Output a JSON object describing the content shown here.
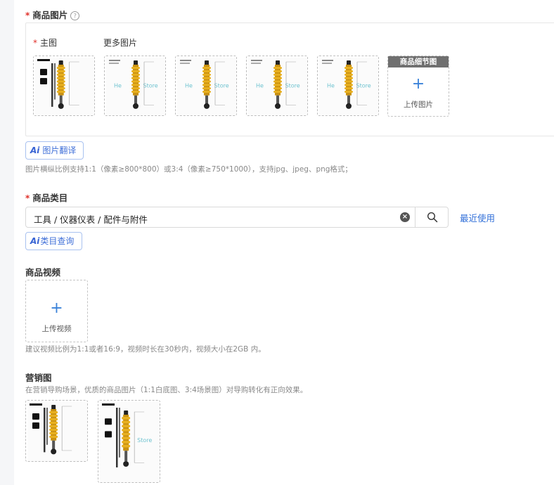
{
  "images_section": {
    "title": "商品图片",
    "main_image_label": "主图",
    "more_images_label": "更多图片",
    "thumbnails": [
      {
        "variant": "main-text"
      },
      {
        "variant": "watermark",
        "watermark_text": "He    Store"
      },
      {
        "variant": "watermark",
        "watermark_text": "He    Store"
      },
      {
        "variant": "watermark",
        "watermark_text": "He    Store"
      },
      {
        "variant": "watermark",
        "watermark_text": "He    Store"
      }
    ],
    "detail_slot": {
      "header": "商品细节图",
      "icon": "plus-icon",
      "label": "上传图片"
    },
    "ai_translate_button": {
      "badge": "Ai",
      "label": "图片翻译"
    },
    "hint": "图片横纵比例支持1:1（像素≥800*800）或3:4（像素≥750*1000），支持jpg、jpeg、png格式；"
  },
  "category_section": {
    "title": "商品类目",
    "value": "工具 / 仪器仪表 / 配件与附件",
    "recent_link": "最近使用",
    "ai_query_button": {
      "badge": "Ai",
      "label": "类目查询"
    }
  },
  "video_section": {
    "title": "商品视频",
    "upload_label": "上传视频",
    "hint": "建议视频比例为1:1或者16:9，视频时长在30秒内，视频大小在2GB 内。"
  },
  "marketing_section": {
    "title": "营销图",
    "hint": "在营销导购场景，优质的商品图片（1:1白底图、3:4场景图）对导购转化有正向效果。"
  },
  "colors": {
    "required_mark": "#e0302a",
    "link": "#2f6ed8",
    "shock_spring": "#e8b020",
    "detail_header": "#6f6f6f"
  }
}
